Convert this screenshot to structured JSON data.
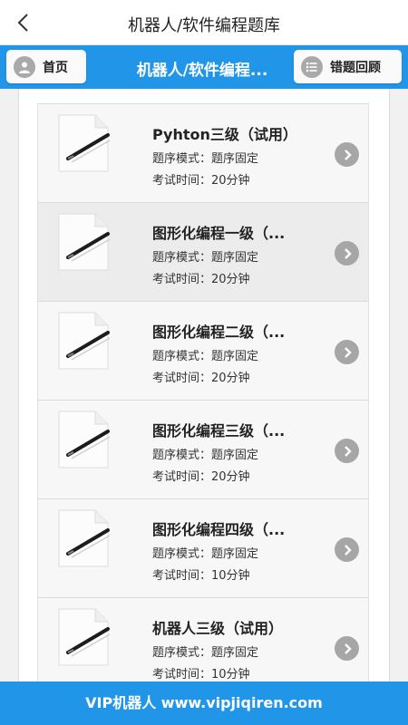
{
  "header": {
    "title": "机器人/软件编程题库",
    "back_icon": "back-arrow-icon"
  },
  "nav": {
    "home_label": "首页",
    "title": "机器人/软件编程...",
    "wrong_label": "错题回顾",
    "bar_color": "#2196e8"
  },
  "list": {
    "items": [
      {
        "title": "Pyhton三级（试用）",
        "mode_label": "题序模式：",
        "mode_value": "题序固定",
        "time_label": "考试时间：",
        "time_value": "20分钟"
      },
      {
        "title": "图形化编程一级（...",
        "mode_label": "题序模式：",
        "mode_value": "题序固定",
        "time_label": "考试时间：",
        "time_value": "20分钟"
      },
      {
        "title": "图形化编程二级（...",
        "mode_label": "题序模式：",
        "mode_value": "题序固定",
        "time_label": "考试时间：",
        "time_value": "20分钟"
      },
      {
        "title": "图形化编程三级（...",
        "mode_label": "题序模式：",
        "mode_value": "题序固定",
        "time_label": "考试时间：",
        "time_value": "20分钟"
      },
      {
        "title": "图形化编程四级（...",
        "mode_label": "题序模式：",
        "mode_value": "题序固定",
        "time_label": "考试时间：",
        "time_value": "10分钟"
      },
      {
        "title": "机器人三级（试用）",
        "mode_label": "题序模式：",
        "mode_value": "题序固定",
        "time_label": "考试时间：",
        "time_value": "10分钟"
      }
    ]
  },
  "footer": {
    "text": "VIP机器人 www.vipjiqiren.com"
  }
}
